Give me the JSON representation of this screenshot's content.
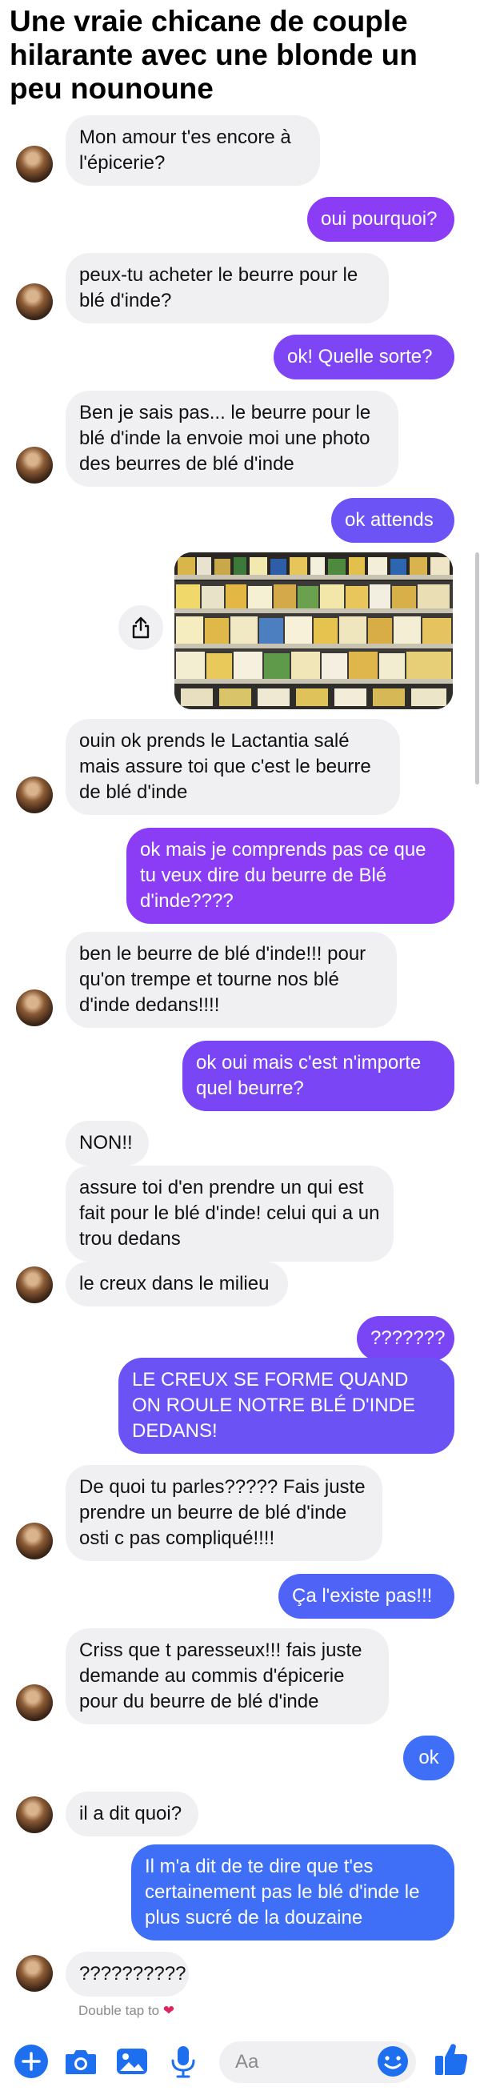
{
  "headline": "Une vraie chicane de couple hilarante avec une blonde un peu nounoune",
  "messages": [
    {
      "text": "Mon amour t'es encore à l'épicerie?"
    },
    {
      "text": "oui pourquoi?"
    },
    {
      "text": "peux-tu acheter le beurre pour le blé d'inde?"
    },
    {
      "text": "ok! Quelle sorte?"
    },
    {
      "text": "Ben je sais pas... le beurre pour le blé d'inde la envoie moi une photo des beurres de blé d'inde"
    },
    {
      "text": "ok attends"
    },
    {
      "text": "ouin ok prends le Lactantia salé mais assure toi que c'est le beurre de blé d'inde"
    },
    {
      "text": "ok mais je comprends pas ce que tu veux dire du beurre de Blé d'inde????"
    },
    {
      "text": "ben le beurre de blé d'inde!!! pour qu'on trempe et tourne nos blé d'inde dedans!!!!"
    },
    {
      "text": "ok oui mais c'est n'importe quel beurre?"
    },
    {
      "text": "NON!!"
    },
    {
      "text": "assure toi d'en prendre un qui est fait pour le blé d'inde! celui qui a un trou dedans"
    },
    {
      "text": "le creux dans le milieu"
    },
    {
      "text": "???????"
    },
    {
      "text": "LE CREUX SE FORME QUAND ON ROULE NOTRE BLÉ D'INDE DEDANS!"
    },
    {
      "text": "De quoi tu parles????? Fais juste prendre un beurre de blé d'inde osti c pas compliqué!!!!"
    },
    {
      "text": "Ça l'existe pas!!!"
    },
    {
      "text": "Criss que t paresseux!!! fais juste demande au commis d'épicerie pour du beurre de blé d'inde"
    },
    {
      "text": "ok"
    },
    {
      "text": "il a dit quoi?"
    },
    {
      "text": "Il m'a dit de te dire que t'es certainement pas le blé d'inde le plus sucré de la douzaine"
    },
    {
      "text": "??????????"
    }
  ],
  "double_tap_hint": "Double tap to",
  "double_tap_icon": "heart-icon",
  "composer": {
    "placeholder": "Aa",
    "icons": [
      "plus-icon",
      "camera-icon",
      "image-icon",
      "microphone-icon",
      "emoji-icon",
      "thumbs-up-icon"
    ]
  },
  "colors": {
    "incoming_bubble": "#f0f0f2",
    "outgoing_top": "#8b3cf5",
    "outgoing_bottom": "#3e6ff6",
    "accent": "#1e6ef0"
  }
}
